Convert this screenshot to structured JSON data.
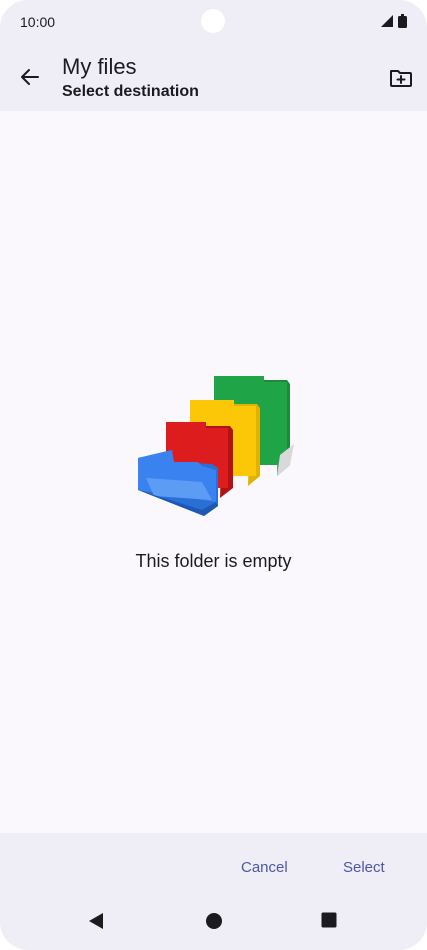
{
  "status_bar": {
    "time": "10:00"
  },
  "app_bar": {
    "title": "My files",
    "subtitle": "Select destination",
    "back_icon": "arrow-back-icon",
    "action_icon": "create-new-folder-icon"
  },
  "content": {
    "empty_message": "This folder is empty"
  },
  "actions": {
    "cancel_label": "Cancel",
    "select_label": "Select"
  },
  "nav_bar": {
    "back": "back-triangle-icon",
    "home": "home-circle-icon",
    "recents": "recents-square-icon"
  },
  "colors": {
    "accent": "#4d57a8",
    "surface": "#efedf6",
    "background": "#fbf8fd"
  }
}
